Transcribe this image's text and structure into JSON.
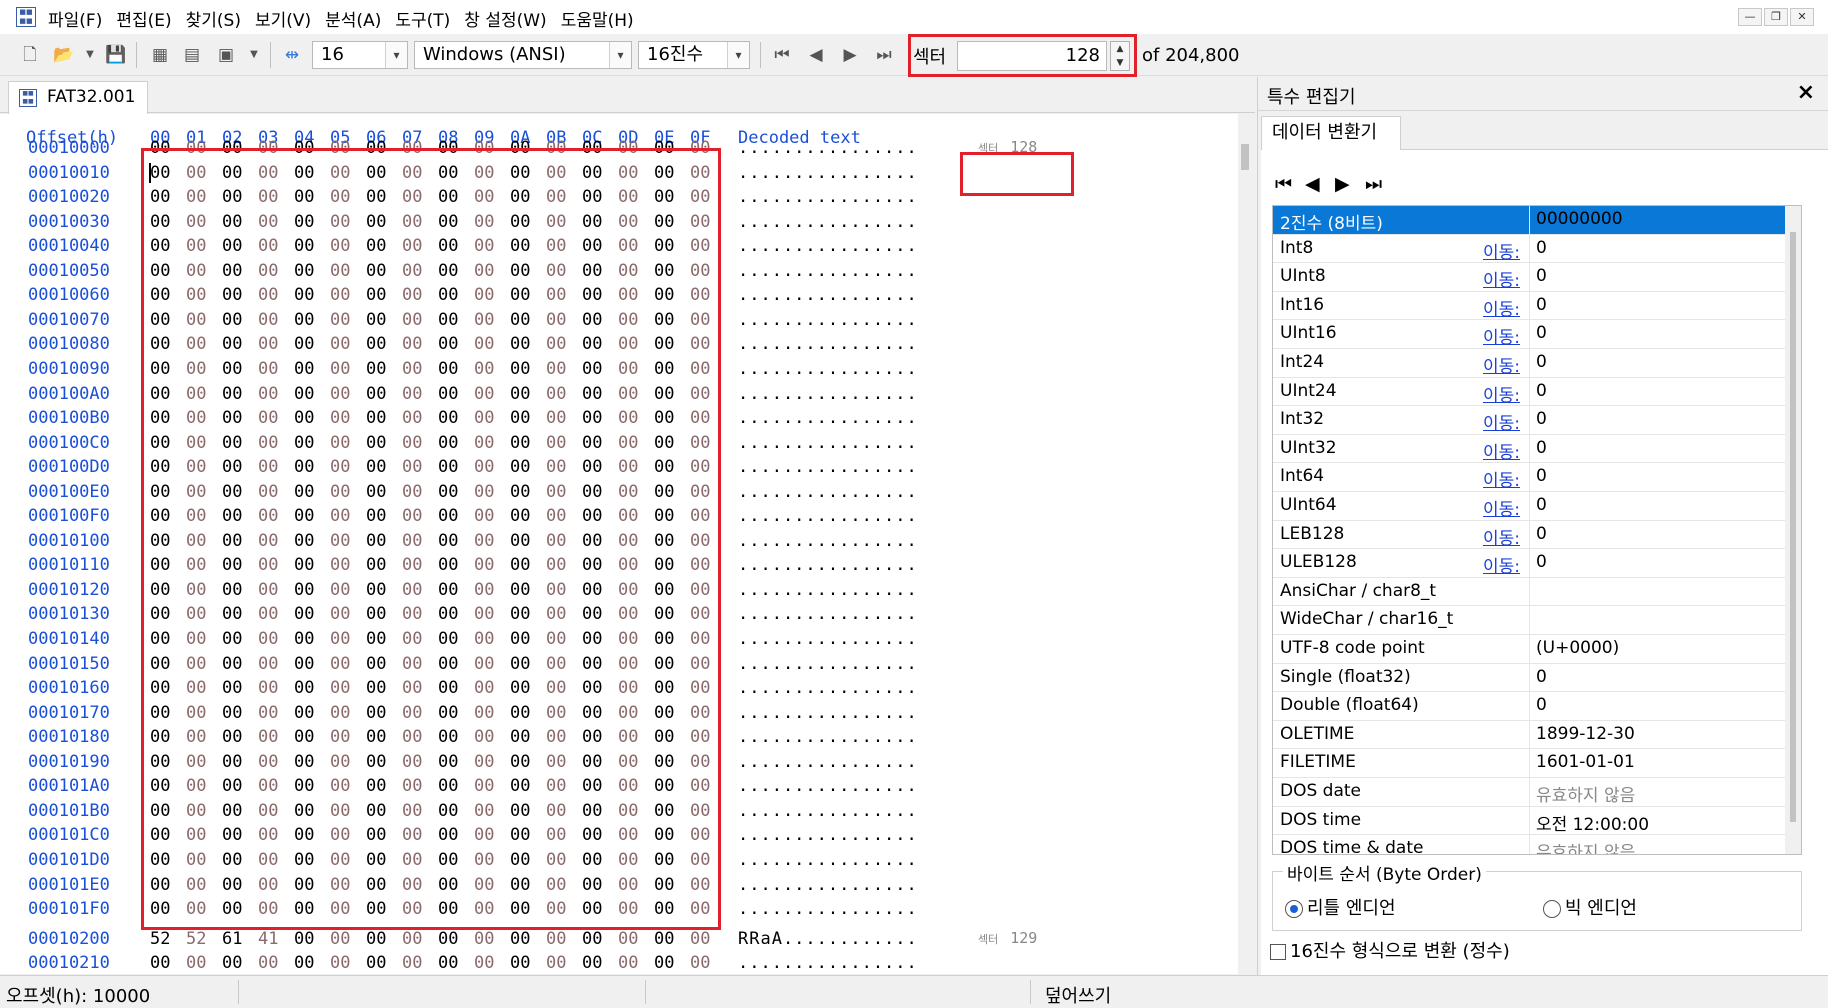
{
  "menu": {
    "items": [
      "파일(F)",
      "편집(E)",
      "찾기(S)",
      "보기(V)",
      "분석(A)",
      "도구(T)",
      "창 설정(W)",
      "도움말(H)"
    ]
  },
  "toolbar": {
    "bytes_per_row": "16",
    "encoding": "Windows (ANSI)",
    "number_base": "16진수",
    "sector_label": "섹터",
    "sector_value": "128",
    "sector_total": "of 204,800"
  },
  "tab": {
    "file_name": "FAT32.001"
  },
  "hex": {
    "offset_header": "Offset(h)",
    "columns": [
      "00",
      "01",
      "02",
      "03",
      "04",
      "05",
      "06",
      "07",
      "08",
      "09",
      "0A",
      "0B",
      "0C",
      "0D",
      "0E",
      "0F"
    ],
    "decoded_header": "Decoded text",
    "sector_marker_prefix": "섹터",
    "rows": [
      {
        "offset": "00010000",
        "bytes": [
          "00",
          "00",
          "00",
          "00",
          "00",
          "00",
          "00",
          "00",
          "00",
          "00",
          "00",
          "00",
          "00",
          "00",
          "00",
          "00"
        ],
        "text": "................",
        "sector": "128"
      },
      {
        "offset": "00010010",
        "bytes": [
          "00",
          "00",
          "00",
          "00",
          "00",
          "00",
          "00",
          "00",
          "00",
          "00",
          "00",
          "00",
          "00",
          "00",
          "00",
          "00"
        ],
        "text": "................"
      },
      {
        "offset": "00010020",
        "bytes": [
          "00",
          "00",
          "00",
          "00",
          "00",
          "00",
          "00",
          "00",
          "00",
          "00",
          "00",
          "00",
          "00",
          "00",
          "00",
          "00"
        ],
        "text": "................"
      },
      {
        "offset": "00010030",
        "bytes": [
          "00",
          "00",
          "00",
          "00",
          "00",
          "00",
          "00",
          "00",
          "00",
          "00",
          "00",
          "00",
          "00",
          "00",
          "00",
          "00"
        ],
        "text": "................"
      },
      {
        "offset": "00010040",
        "bytes": [
          "00",
          "00",
          "00",
          "00",
          "00",
          "00",
          "00",
          "00",
          "00",
          "00",
          "00",
          "00",
          "00",
          "00",
          "00",
          "00"
        ],
        "text": "................"
      },
      {
        "offset": "00010050",
        "bytes": [
          "00",
          "00",
          "00",
          "00",
          "00",
          "00",
          "00",
          "00",
          "00",
          "00",
          "00",
          "00",
          "00",
          "00",
          "00",
          "00"
        ],
        "text": "................"
      },
      {
        "offset": "00010060",
        "bytes": [
          "00",
          "00",
          "00",
          "00",
          "00",
          "00",
          "00",
          "00",
          "00",
          "00",
          "00",
          "00",
          "00",
          "00",
          "00",
          "00"
        ],
        "text": "................"
      },
      {
        "offset": "00010070",
        "bytes": [
          "00",
          "00",
          "00",
          "00",
          "00",
          "00",
          "00",
          "00",
          "00",
          "00",
          "00",
          "00",
          "00",
          "00",
          "00",
          "00"
        ],
        "text": "................"
      },
      {
        "offset": "00010080",
        "bytes": [
          "00",
          "00",
          "00",
          "00",
          "00",
          "00",
          "00",
          "00",
          "00",
          "00",
          "00",
          "00",
          "00",
          "00",
          "00",
          "00"
        ],
        "text": "................"
      },
      {
        "offset": "00010090",
        "bytes": [
          "00",
          "00",
          "00",
          "00",
          "00",
          "00",
          "00",
          "00",
          "00",
          "00",
          "00",
          "00",
          "00",
          "00",
          "00",
          "00"
        ],
        "text": "................"
      },
      {
        "offset": "000100A0",
        "bytes": [
          "00",
          "00",
          "00",
          "00",
          "00",
          "00",
          "00",
          "00",
          "00",
          "00",
          "00",
          "00",
          "00",
          "00",
          "00",
          "00"
        ],
        "text": "................"
      },
      {
        "offset": "000100B0",
        "bytes": [
          "00",
          "00",
          "00",
          "00",
          "00",
          "00",
          "00",
          "00",
          "00",
          "00",
          "00",
          "00",
          "00",
          "00",
          "00",
          "00"
        ],
        "text": "................"
      },
      {
        "offset": "000100C0",
        "bytes": [
          "00",
          "00",
          "00",
          "00",
          "00",
          "00",
          "00",
          "00",
          "00",
          "00",
          "00",
          "00",
          "00",
          "00",
          "00",
          "00"
        ],
        "text": "................"
      },
      {
        "offset": "000100D0",
        "bytes": [
          "00",
          "00",
          "00",
          "00",
          "00",
          "00",
          "00",
          "00",
          "00",
          "00",
          "00",
          "00",
          "00",
          "00",
          "00",
          "00"
        ],
        "text": "................"
      },
      {
        "offset": "000100E0",
        "bytes": [
          "00",
          "00",
          "00",
          "00",
          "00",
          "00",
          "00",
          "00",
          "00",
          "00",
          "00",
          "00",
          "00",
          "00",
          "00",
          "00"
        ],
        "text": "................"
      },
      {
        "offset": "000100F0",
        "bytes": [
          "00",
          "00",
          "00",
          "00",
          "00",
          "00",
          "00",
          "00",
          "00",
          "00",
          "00",
          "00",
          "00",
          "00",
          "00",
          "00"
        ],
        "text": "................"
      },
      {
        "offset": "00010100",
        "bytes": [
          "00",
          "00",
          "00",
          "00",
          "00",
          "00",
          "00",
          "00",
          "00",
          "00",
          "00",
          "00",
          "00",
          "00",
          "00",
          "00"
        ],
        "text": "................"
      },
      {
        "offset": "00010110",
        "bytes": [
          "00",
          "00",
          "00",
          "00",
          "00",
          "00",
          "00",
          "00",
          "00",
          "00",
          "00",
          "00",
          "00",
          "00",
          "00",
          "00"
        ],
        "text": "................"
      },
      {
        "offset": "00010120",
        "bytes": [
          "00",
          "00",
          "00",
          "00",
          "00",
          "00",
          "00",
          "00",
          "00",
          "00",
          "00",
          "00",
          "00",
          "00",
          "00",
          "00"
        ],
        "text": "................"
      },
      {
        "offset": "00010130",
        "bytes": [
          "00",
          "00",
          "00",
          "00",
          "00",
          "00",
          "00",
          "00",
          "00",
          "00",
          "00",
          "00",
          "00",
          "00",
          "00",
          "00"
        ],
        "text": "................"
      },
      {
        "offset": "00010140",
        "bytes": [
          "00",
          "00",
          "00",
          "00",
          "00",
          "00",
          "00",
          "00",
          "00",
          "00",
          "00",
          "00",
          "00",
          "00",
          "00",
          "00"
        ],
        "text": "................"
      },
      {
        "offset": "00010150",
        "bytes": [
          "00",
          "00",
          "00",
          "00",
          "00",
          "00",
          "00",
          "00",
          "00",
          "00",
          "00",
          "00",
          "00",
          "00",
          "00",
          "00"
        ],
        "text": "................"
      },
      {
        "offset": "00010160",
        "bytes": [
          "00",
          "00",
          "00",
          "00",
          "00",
          "00",
          "00",
          "00",
          "00",
          "00",
          "00",
          "00",
          "00",
          "00",
          "00",
          "00"
        ],
        "text": "................"
      },
      {
        "offset": "00010170",
        "bytes": [
          "00",
          "00",
          "00",
          "00",
          "00",
          "00",
          "00",
          "00",
          "00",
          "00",
          "00",
          "00",
          "00",
          "00",
          "00",
          "00"
        ],
        "text": "................"
      },
      {
        "offset": "00010180",
        "bytes": [
          "00",
          "00",
          "00",
          "00",
          "00",
          "00",
          "00",
          "00",
          "00",
          "00",
          "00",
          "00",
          "00",
          "00",
          "00",
          "00"
        ],
        "text": "................"
      },
      {
        "offset": "00010190",
        "bytes": [
          "00",
          "00",
          "00",
          "00",
          "00",
          "00",
          "00",
          "00",
          "00",
          "00",
          "00",
          "00",
          "00",
          "00",
          "00",
          "00"
        ],
        "text": "................"
      },
      {
        "offset": "000101A0",
        "bytes": [
          "00",
          "00",
          "00",
          "00",
          "00",
          "00",
          "00",
          "00",
          "00",
          "00",
          "00",
          "00",
          "00",
          "00",
          "00",
          "00"
        ],
        "text": "................"
      },
      {
        "offset": "000101B0",
        "bytes": [
          "00",
          "00",
          "00",
          "00",
          "00",
          "00",
          "00",
          "00",
          "00",
          "00",
          "00",
          "00",
          "00",
          "00",
          "00",
          "00"
        ],
        "text": "................"
      },
      {
        "offset": "000101C0",
        "bytes": [
          "00",
          "00",
          "00",
          "00",
          "00",
          "00",
          "00",
          "00",
          "00",
          "00",
          "00",
          "00",
          "00",
          "00",
          "00",
          "00"
        ],
        "text": "................"
      },
      {
        "offset": "000101D0",
        "bytes": [
          "00",
          "00",
          "00",
          "00",
          "00",
          "00",
          "00",
          "00",
          "00",
          "00",
          "00",
          "00",
          "00",
          "00",
          "00",
          "00"
        ],
        "text": "................"
      },
      {
        "offset": "000101E0",
        "bytes": [
          "00",
          "00",
          "00",
          "00",
          "00",
          "00",
          "00",
          "00",
          "00",
          "00",
          "00",
          "00",
          "00",
          "00",
          "00",
          "00"
        ],
        "text": "................"
      },
      {
        "offset": "000101F0",
        "bytes": [
          "00",
          "00",
          "00",
          "00",
          "00",
          "00",
          "00",
          "00",
          "00",
          "00",
          "00",
          "00",
          "00",
          "00",
          "00",
          "00"
        ],
        "text": "................"
      },
      {
        "offset": "00010200",
        "bytes": [
          "52",
          "52",
          "61",
          "41",
          "00",
          "00",
          "00",
          "00",
          "00",
          "00",
          "00",
          "00",
          "00",
          "00",
          "00",
          "00"
        ],
        "text": "RRaA............",
        "sector": "129"
      },
      {
        "offset": "00010210",
        "bytes": [
          "00",
          "00",
          "00",
          "00",
          "00",
          "00",
          "00",
          "00",
          "00",
          "00",
          "00",
          "00",
          "00",
          "00",
          "00",
          "00"
        ],
        "text": "................"
      }
    ]
  },
  "panel": {
    "title": "특수 편집기",
    "tab": "데이터 변환기",
    "goto_label": "이동:",
    "rows": [
      {
        "name": "2진수 (8비트)",
        "value": "00000000",
        "selected": true,
        "link": false
      },
      {
        "name": "Int8",
        "value": "0",
        "link": true
      },
      {
        "name": "UInt8",
        "value": "0",
        "link": true
      },
      {
        "name": "Int16",
        "value": "0",
        "link": true
      },
      {
        "name": "UInt16",
        "value": "0",
        "link": true
      },
      {
        "name": "Int24",
        "value": "0",
        "link": true
      },
      {
        "name": "UInt24",
        "value": "0",
        "link": true
      },
      {
        "name": "Int32",
        "value": "0",
        "link": true
      },
      {
        "name": "UInt32",
        "value": "0",
        "link": true
      },
      {
        "name": "Int64",
        "value": "0",
        "link": true
      },
      {
        "name": "UInt64",
        "value": "0",
        "link": true
      },
      {
        "name": "LEB128",
        "value": "0",
        "link": true
      },
      {
        "name": "ULEB128",
        "value": "0",
        "link": true
      },
      {
        "name": "AnsiChar / char8_t",
        "value": "",
        "link": false
      },
      {
        "name": "WideChar / char16_t",
        "value": "",
        "link": false
      },
      {
        "name": "UTF-8 code point",
        "value": "  (U+0000)",
        "link": false
      },
      {
        "name": "Single (float32)",
        "value": "0",
        "link": false
      },
      {
        "name": "Double (float64)",
        "value": "0",
        "link": false
      },
      {
        "name": "OLETIME",
        "value": "1899-12-30",
        "link": false
      },
      {
        "name": "FILETIME",
        "value": "1601-01-01",
        "link": false
      },
      {
        "name": "DOS date",
        "value": "유효하지 않음",
        "link": false,
        "muted": true
      },
      {
        "name": "DOS time",
        "value": "오전 12:00:00",
        "link": false
      },
      {
        "name": "DOS time & date",
        "value": "유효하지 않음",
        "link": false,
        "muted": true
      }
    ],
    "byte_order_label": "바이트 순서 (Byte Order)",
    "little_endian": "리틀 엔디언",
    "big_endian": "빅 엔디언",
    "hex_convert_label": "16진수 형식으로 변환 (정수)"
  },
  "status": {
    "offset": "오프셋(h): 10000",
    "mode": "덮어쓰기"
  }
}
